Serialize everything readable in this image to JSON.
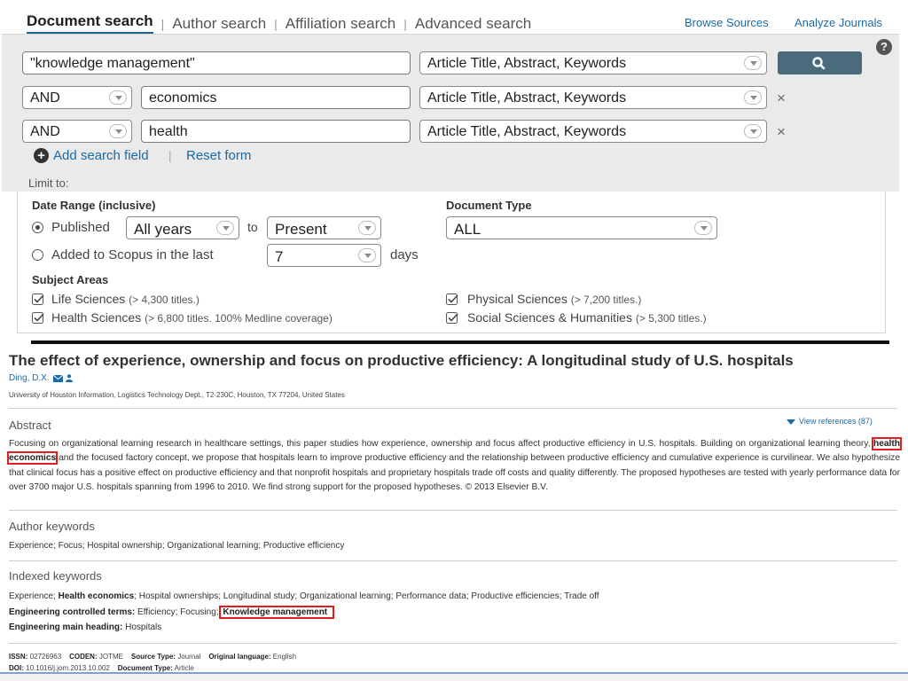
{
  "tabs": {
    "items": [
      "Document search",
      "Author search",
      "Affiliation search",
      "Advanced search"
    ],
    "browse_sources": "Browse Sources",
    "analyze_journals": "Analyze Journals"
  },
  "help_label": "?",
  "search_form": {
    "row1": {
      "term": "\"knowledge management\"",
      "field": "Article Title, Abstract, Keywords"
    },
    "row2": {
      "operator": "AND",
      "term": "economics",
      "field": "Article Title, Abstract, Keywords"
    },
    "row3": {
      "operator": "AND",
      "term": "health",
      "field": "Article Title, Abstract, Keywords"
    },
    "remove_symbol": "×",
    "add_search_field": "Add search field",
    "separator": "|",
    "reset_form": "Reset form",
    "limit_to": "Limit to:"
  },
  "limits": {
    "date_range_label": "Date Range (inclusive)",
    "published_label": "Published",
    "published_from": "All years",
    "to_label": "to",
    "published_to": "Present",
    "added_label": "Added to Scopus in the last",
    "added_days": "7",
    "days_label": "days",
    "document_type_label": "Document Type",
    "document_type": "ALL",
    "subject_areas_label": "Subject Areas",
    "subjects": [
      {
        "name": "Life Sciences",
        "note": "(> 4,300 titles.)"
      },
      {
        "name": "Health Sciences",
        "note": "(> 6,800 titles. 100% Medline coverage)"
      },
      {
        "name": "Physical Sciences",
        "note": "(> 7,200 titles.)"
      },
      {
        "name": "Social Sciences & Humanities",
        "note": "(> 5,300 titles.)"
      }
    ]
  },
  "document": {
    "title": "The effect of experience, ownership and focus on productive efficiency: A longitudinal study of U.S. hospitals",
    "author": "Ding, D.X.",
    "affiliation": "University of Houston Information, Logistics Technology Dept., T2-230C, Houston, TX 77204, United States",
    "abstract_heading": "Abstract",
    "view_references": "View references (87)",
    "abstract_before": "Focusing on organizational learning research in healthcare settings, this paper studies how experience, ownership and focus affect productive efficiency in U.S. hospitals. Building on organizational learning theory,",
    "abstract_highlight": "health economics",
    "abstract_after": "and the focused factory concept, we propose that hospitals learn to improve productive efficiency and the relationship between productive efficiency and cumulative experience is curvilinear. We also hypothesize that clinical focus has a positive effect on productive efficiency and that nonprofit hospitals and proprietary hospitals trade off costs and quality differently. The proposed hypotheses are tested with yearly performance data for over 3700 major U.S. hospitals spanning from 1996 to 2010. We find strong support for the proposed hypotheses. © 2013 Elsevier B.V.",
    "author_keywords_heading": "Author keywords",
    "author_keywords": "Experience; Focus; Hospital ownership; Organizational learning; Productive efficiency",
    "indexed_keywords_heading": "Indexed keywords",
    "indexed_first": "Experience;",
    "indexed_bold": "Health economics",
    "indexed_rest": "; Hospital ownerships; Longitudinal study; Organizational learning; Performance data; Productive efficiencies; Trade off",
    "controlled_label": "Engineering controlled terms:",
    "controlled_terms": "Efficiency; Focusing;",
    "controlled_highlight": "Knowledge management",
    "main_heading_label": "Engineering main heading:",
    "main_heading": "Hospitals",
    "issn_label": "ISSN:",
    "issn": "02726963",
    "coden_label": "CODEN:",
    "coden": "JOTME",
    "source_type_label": "Source Type:",
    "source_type": "Journal",
    "language_label": "Original language:",
    "language": "English",
    "doi_label": "DOI:",
    "doi": "10.1016/j.jom.2013.10.002",
    "doc_type_label": "Document Type:",
    "doc_type": "Article"
  },
  "colors": {
    "link": "#1a6aa6",
    "highlight_box": "#e01e1e",
    "search_button": "#4a6b7b",
    "panel": "#eaeaea"
  }
}
